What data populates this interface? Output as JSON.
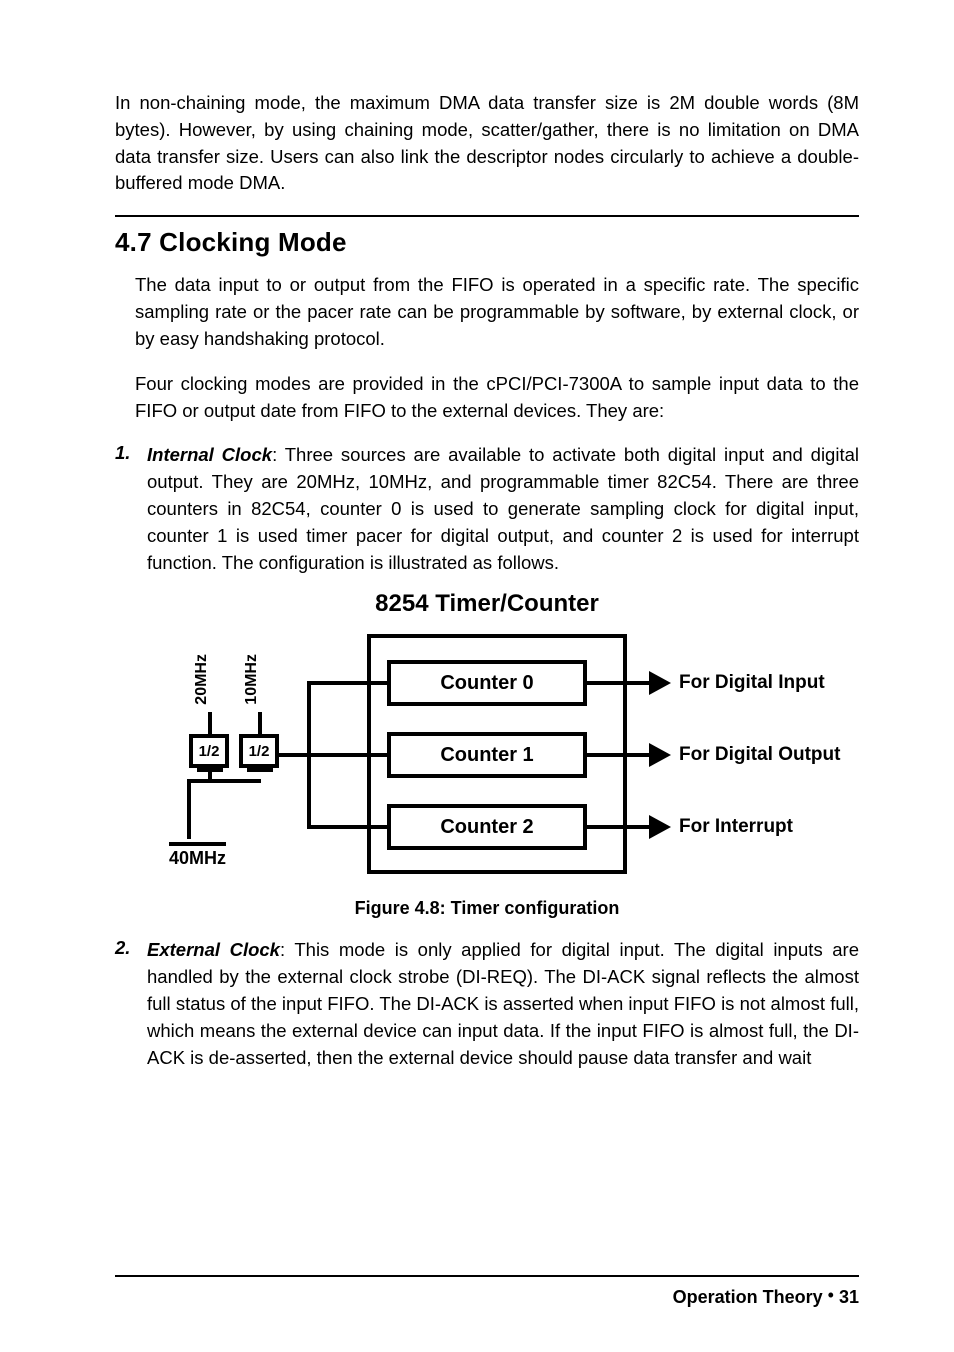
{
  "intro_para": "In non-chaining mode, the maximum DMA data transfer size is 2M double words (8M bytes). However, by using chaining mode, scatter/gather, there is no limitation on DMA data transfer size. Users can also link the descriptor nodes circularly to achieve a double-buffered mode DMA.",
  "section_heading": "4.7  Clocking Mode",
  "para1": "The data input to or output from the FIFO is operated in a specific rate. The specific sampling rate or the pacer rate can be programmable by software, by external clock, or by easy handshaking protocol.",
  "para2": "Four clocking modes are provided in the cPCI/PCI-7300A to sample input data to the FIFO or output date from FIFO to the external devices. They are:",
  "items": [
    {
      "num": "1.",
      "term": "Internal Clock",
      "sep": ": ",
      "rest": "Three sources are available to activate both digital input and digital output. They are 20MHz, 10MHz, and programmable timer 82C54. There are three counters in 82C54, counter 0 is used to generate sampling clock for digital input, counter 1 is used timer pacer for digital output, and counter 2 is used for interrupt function. The configuration is illustrated as follows."
    },
    {
      "num": "2.",
      "term": "External Clock",
      "sep": ": ",
      "rest": "This mode is only applied for digital input. The digital inputs are handled by the external clock strobe (DI-REQ). The DI-ACK signal reflects the almost full status of the input FIFO. The DI-ACK is asserted when input FIFO is not almost full, which means the external device can input data. If the input FIFO is almost full, the DI-ACK is de-asserted, then the external device should pause data transfer and wait"
    }
  ],
  "figure": {
    "title": "8254 Timer/Counter",
    "counters": [
      "Counter 0",
      "Counter 1",
      "Counter 2"
    ],
    "outputs": [
      "For Digital Input",
      "For Digital Output",
      "For Interrupt"
    ],
    "left_labels": {
      "l20": "20MHz",
      "l10": "10MHz",
      "div": "1/2",
      "base": "40MHz"
    },
    "caption": "Figure 4.8: Timer configuration"
  },
  "footer": {
    "section": "Operation Theory",
    "bullet": "•",
    "page": "31"
  }
}
